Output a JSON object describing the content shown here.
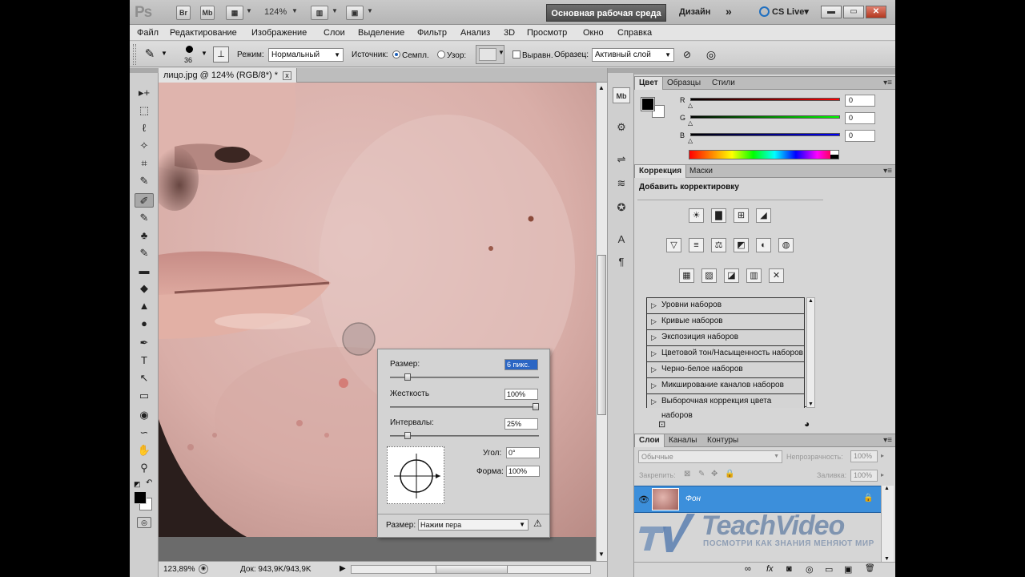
{
  "titlebar": {
    "ps_logo": "Ps",
    "br": "Br",
    "mb": "Mb",
    "zoom": "124%",
    "workspace_active": "Основная рабочая среда",
    "workspace_design": "Дизайн",
    "more": "»",
    "cslive": "CS Live",
    "cslive_arrow": "▾",
    "min": "▬",
    "max": "▭",
    "close": "✕"
  },
  "menu": [
    "Файл",
    "Редактирование",
    "Изображение",
    "Слои",
    "Выделение",
    "Фильтр",
    "Анализ",
    "3D",
    "Просмотр",
    "Окно",
    "Справка"
  ],
  "options": {
    "brush_size": "36",
    "mode_label": "Режим:",
    "mode_value": "Нормальный",
    "source_label": "Источник:",
    "sampled_label": "Семпл.",
    "pattern_label": "Узор:",
    "aligned_label": "Выравн.",
    "sample_label": "Образец:",
    "sample_value": "Активный слой"
  },
  "document": {
    "tab_title": "лицо.jpg @ 124% (RGB/8*) *",
    "tab_close": "x",
    "status_zoom": "123,89%",
    "status_doc": "Док: 943,9K/943,9K",
    "status_arrow": "▶"
  },
  "brush_popup": {
    "size_label": "Размер:",
    "size_value": "6 пикс.",
    "size_frac": 0.1,
    "hardness_label": "Жесткость",
    "hardness_value": "100%",
    "hardness_frac": 1.0,
    "spacing_label": "Интервалы:",
    "spacing_value": "25%",
    "spacing_frac": 0.1,
    "angle_label": "Угол:",
    "angle_value": "0°",
    "roundness_label": "Форма:",
    "roundness_value": "100%",
    "size_ctrl_label": "Размер:",
    "size_ctrl_value": "Нажим пера",
    "warning": "⚠"
  },
  "color_panel": {
    "tabs": [
      "Цвет",
      "Образцы",
      "Стили"
    ],
    "channels": [
      {
        "label": "R",
        "value": "0",
        "color": "#c00000"
      },
      {
        "label": "G",
        "value": "0",
        "color": "#00b000"
      },
      {
        "label": "B",
        "value": "0",
        "color": "#0000c8"
      }
    ]
  },
  "adjust_panel": {
    "tabs": [
      "Коррекция",
      "Маски"
    ],
    "heading": "Добавить корректировку",
    "icons_row1": [
      "☀",
      "▇",
      "⊞",
      "◢"
    ],
    "icons_row2": [
      "▽",
      "≡",
      "⚖",
      "◩",
      "◐",
      "◍"
    ],
    "icons_row3": [
      "▦",
      "▨",
      "◪",
      "▥",
      "✕"
    ],
    "presets": [
      "Уровни наборов",
      "Кривые наборов",
      "Экспозиция наборов",
      "Цветовой тон/Насыщенность наборов",
      "Черно-белое наборов",
      "Микширование каналов наборов",
      "Выборочная коррекция цвета наборов"
    ]
  },
  "layers_panel": {
    "tabs": [
      "Слои",
      "Каналы",
      "Контуры"
    ],
    "blend_mode": "Обычные",
    "opacity_label": "Непрозрачность:",
    "opacity_value": "100%",
    "lock_label": "Закрепить:",
    "fill_label": "Заливка:",
    "fill_value": "100%",
    "layer_name": "Фон",
    "footer_icons": [
      "∞",
      "fx",
      "◙",
      "◎",
      "▭",
      "▣",
      "🗑"
    ]
  },
  "watermark": {
    "brand": "TeachVideo",
    "tagline": "ПОСМОТРИ КАК ЗНАНИЯ МЕНЯЮТ МИР"
  },
  "tools": [
    "▸+",
    "⬚",
    "ℓ",
    "✧",
    "⌗",
    "✎",
    "✐",
    "✎",
    "♣",
    "✎",
    "▬",
    "◆",
    "▲",
    "●",
    "✒",
    "T",
    "↖",
    "▭",
    "◉",
    "∽",
    "✋",
    "⚲"
  ],
  "dock_icons": [
    "Mb",
    "⚙",
    "⇌",
    "≋",
    "✪",
    "⊥",
    "A",
    "¶"
  ]
}
